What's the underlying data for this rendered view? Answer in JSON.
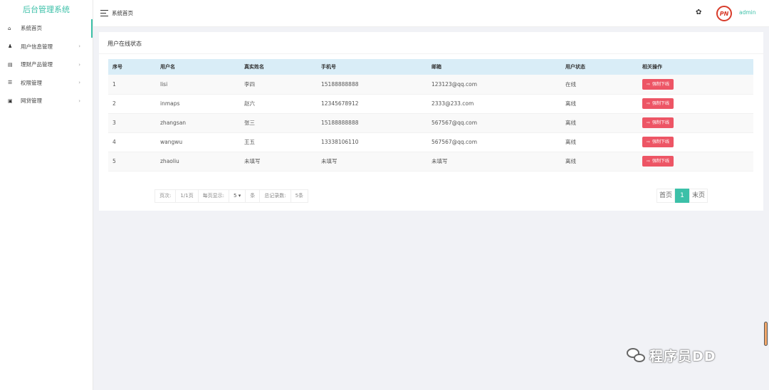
{
  "app": {
    "title": "后台管理系统"
  },
  "sidebar": {
    "items": [
      {
        "label": "系统首页",
        "icon": "home-icon",
        "glyph": "⌂"
      },
      {
        "label": "用户信息管理",
        "icon": "users-icon",
        "glyph": "♟"
      },
      {
        "label": "理财产品管理",
        "icon": "copy-icon",
        "glyph": "▤"
      },
      {
        "label": "权限管理",
        "icon": "sliders-icon",
        "glyph": "☰"
      },
      {
        "label": "网贷管理",
        "icon": "message-icon",
        "glyph": "▣"
      }
    ],
    "arrow": "›"
  },
  "header": {
    "breadcrumb": "系统首页",
    "user": "admin",
    "logo_text": "PN"
  },
  "panel": {
    "title": "用户在线状态"
  },
  "table": {
    "headers": [
      "序号",
      "用户名",
      "真实姓名",
      "手机号",
      "邮箱",
      "用户状态",
      "相关操作"
    ],
    "action_label": "强制下线",
    "rows": [
      {
        "no": "1",
        "username": "lisi",
        "realname": "李四",
        "phone": "15188888888",
        "email": "123123@qq.com",
        "status": "在线"
      },
      {
        "no": "2",
        "username": "inmaps",
        "realname": "赵六",
        "phone": "12345678912",
        "email": "2333@233.com",
        "status": "离线"
      },
      {
        "no": "3",
        "username": "zhangsan",
        "realname": "张三",
        "phone": "15188888888",
        "email": "567567@qq.com",
        "status": "离线"
      },
      {
        "no": "4",
        "username": "wangwu",
        "realname": "王五",
        "phone": "13338106110",
        "email": "567567@qq.com",
        "status": "离线"
      },
      {
        "no": "5",
        "username": "zhaoliu",
        "realname": "未填写",
        "phone": "未填写",
        "email": "未填写",
        "status": "离线"
      }
    ]
  },
  "pagination": {
    "page_label": "页次:",
    "page_value": "1/1页",
    "per_page_label": "每页显示:",
    "per_page_value": "5",
    "per_page_unit": "条",
    "total_label": "总记录数:",
    "total_value": "5条",
    "first": "首页",
    "current": "1",
    "last": "末页"
  },
  "watermark": "程序员DD",
  "colors": {
    "accent": "#3cc0a8",
    "danger": "#ed5565",
    "header_bg": "#d9edf7"
  }
}
